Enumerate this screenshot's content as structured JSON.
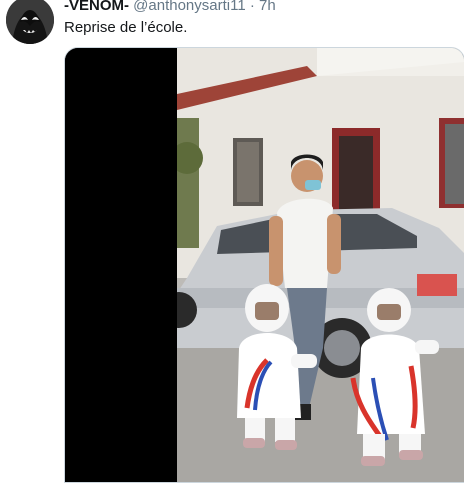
{
  "tweet": {
    "display_name": "-VENOM-",
    "handle": "@anthonysarti11",
    "separator": "·",
    "time": "7h",
    "text": "Reprise de l’école."
  },
  "icons": {
    "avatar": "venom-avatar",
    "media": "video-thumbnail"
  }
}
